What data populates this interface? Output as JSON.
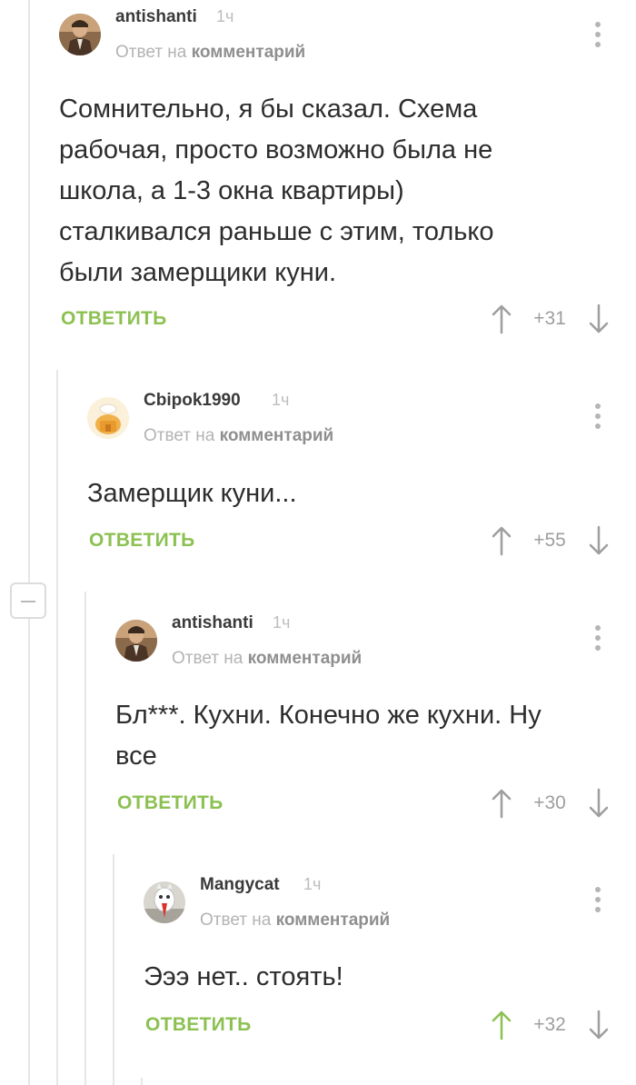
{
  "comments": [
    {
      "username": "antishanti",
      "time": "1ч",
      "reply_prefix": "Ответ на",
      "reply_link": "комментарий",
      "text": "Сомнительно, я бы сказал. Схема рабочая, просто возможно была не школа, а 1-3 окна квартиры) сталкивался раньше с этим, только были замерщики куни.",
      "reply_label": "ОТВЕТИТЬ",
      "score": "+31",
      "upvoted": false
    },
    {
      "username": "Cbipok1990",
      "time": "1ч",
      "reply_prefix": "Ответ на",
      "reply_link": "комментарий",
      "text": "Замерщик куни...",
      "reply_label": "ОТВЕТИТЬ",
      "score": "+55",
      "upvoted": false
    },
    {
      "username": "antishanti",
      "time": "1ч",
      "reply_prefix": "Ответ на",
      "reply_link": "комментарий",
      "text": "Бл***. Кухни. Конечно же кухни. Ну все",
      "reply_label": "ОТВЕТИТЬ",
      "score": "+30",
      "upvoted": false
    },
    {
      "username": "Mangycat",
      "time": "1ч",
      "reply_prefix": "Ответ на",
      "reply_link": "комментарий",
      "text": "Эээ нет.. стоять!",
      "reply_label": "ОТВЕТИТЬ",
      "score": "+32",
      "upvoted": true
    }
  ],
  "icons": {
    "more": "more-vertical-icon",
    "up": "arrow-up-icon",
    "down": "arrow-down-icon",
    "collapse": "minus-icon"
  },
  "colors": {
    "accent_green": "#8cc152",
    "text": "#2d2d2d",
    "meta": "#b3b3b3",
    "thread_line": "#e6e6e6",
    "vote_gray": "#9e9e9e"
  }
}
